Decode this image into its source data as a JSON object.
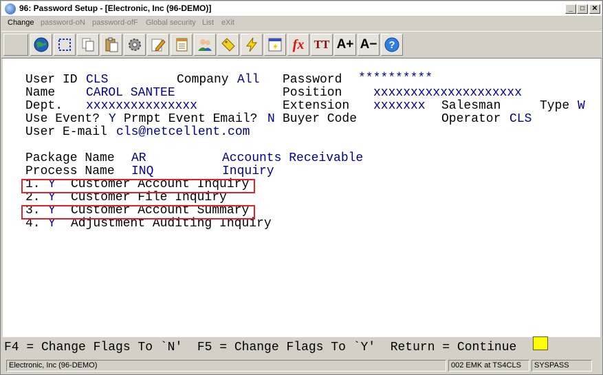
{
  "window": {
    "title": "96: Password Setup - [Electronic, Inc (96-DEMO)]",
    "controls": {
      "minimize": "_",
      "maximize": "□",
      "close": "✕"
    }
  },
  "menu": [
    {
      "label": "Change",
      "enabled": true
    },
    {
      "label": "password-oN",
      "enabled": false
    },
    {
      "label": "password-ofF",
      "enabled": false
    },
    {
      "label": "Global security",
      "enabled": false
    },
    {
      "label": "List",
      "enabled": false
    },
    {
      "label": "eXit",
      "enabled": false
    }
  ],
  "toolbar": {
    "icons": [
      "globe-icon",
      "select-icon",
      "copy-icon",
      "paste-icon",
      "settings-icon",
      "edit-icon",
      "document-icon",
      "users-icon",
      "tag-icon",
      "lightning-icon",
      "form-icon",
      "function-icon",
      "font-style-icon",
      "font-larger-icon",
      "font-smaller-icon",
      "help-icon"
    ],
    "glyphs": {
      "function": "fx",
      "font_style": "TT",
      "font_larger": "A+",
      "font_smaller": "A−",
      "help": "?"
    }
  },
  "form": {
    "user_id_label": "User ID",
    "user_id": "CLS",
    "company_label": "Company",
    "company": "All",
    "password_label": "Password",
    "password": "**********",
    "name_label": "Name",
    "name": "CAROL SANTEE",
    "position_label": "Position",
    "position": "xxxxxxxxxxxxxxxxxxxx",
    "dept_label": "Dept.",
    "dept": "xxxxxxxxxxxxxxx",
    "extension_label": "Extension",
    "extension": "xxxxxxx",
    "salesman_label": "Salesman",
    "type_label": "Type",
    "type": "W",
    "use_event_label": "Use Event?",
    "use_event": "Y",
    "prompt_email_label": "Prmpt Event Email?",
    "prompt_email": "N",
    "buyer_code_label": "Buyer Code",
    "operator_label": "Operator",
    "operator": "CLS",
    "email_label": "User E-mail",
    "email": "cls@netcellent.com",
    "package_label": "Package Name",
    "package": "AR",
    "package_desc": "Accounts Receivable",
    "process_label": "Process Name",
    "process": "INQ",
    "process_desc": "Inquiry"
  },
  "flags": [
    {
      "num": "1.",
      "flag": "Y",
      "label": "Customer Account Inquiry"
    },
    {
      "num": "2.",
      "flag": "Y",
      "label": "Customer File Inquiry"
    },
    {
      "num": "3.",
      "flag": "Y",
      "label": "Customer Account Summary"
    },
    {
      "num": "4.",
      "flag": "Y",
      "label": "Adjustment Auditing Inquiry"
    }
  ],
  "function_bar": "F4 = Change Flags To `N'  F5 = Change Flags To `Y'  Return = Continue",
  "statusbar": {
    "company": "Electronic, Inc (96-DEMO)",
    "session": "002 EMK at TS4CLS",
    "app": "SYSPASS"
  },
  "colors": {
    "label": "#000000",
    "value": "#00008b",
    "highlight": "#e0202a",
    "cursor": "#ffff00"
  }
}
